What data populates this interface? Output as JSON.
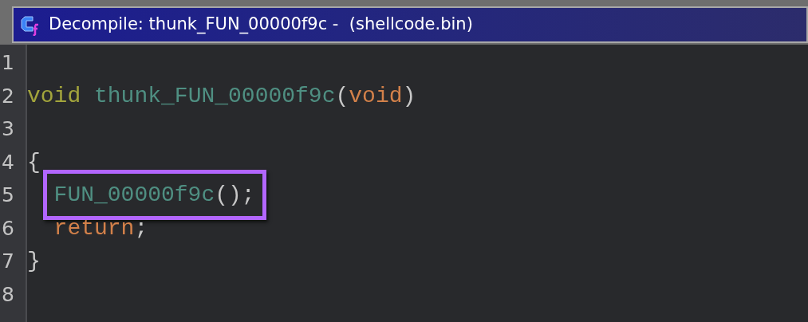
{
  "window": {
    "title": "Decompile: thunk_FUN_00000f9c -  (shellcode.bin)"
  },
  "lines": [
    {
      "number": "1",
      "highlighted": false
    },
    {
      "number": "2",
      "highlighted": false,
      "tokens": [
        {
          "text": "void",
          "kind": "type"
        },
        {
          "text": "thunk_FUN_00000f9c",
          "kind": "function"
        },
        {
          "text": "(",
          "kind": "punct"
        },
        {
          "text": "void",
          "kind": "keyword"
        },
        {
          "text": ")",
          "kind": "punct"
        }
      ]
    },
    {
      "number": "3",
      "highlighted": false
    },
    {
      "number": "4",
      "highlighted": false,
      "tokens": [
        {
          "text": "{",
          "kind": "punct"
        }
      ],
      "children": [
        {
          "number": "5",
          "highlighted": true,
          "tokens": [
            {
              "text": "FUN_00000f9c",
              "kind": "function"
            },
            {
              "text": "();",
              "kind": "punct"
            }
          ]
        },
        {
          "number": "6",
          "highlighted": false,
          "tokens": [
            {
              "text": "return",
              "kind": "keyword"
            },
            {
              "text": ";",
              "kind": "punct"
            }
          ]
        }
      ]
    },
    {
      "number": "7",
      "highlighted": false,
      "tokens": [
        {
          "text": "}",
          "kind": "punct"
        }
      ]
    },
    {
      "number": "8",
      "highlighted": false
    }
  ]
}
